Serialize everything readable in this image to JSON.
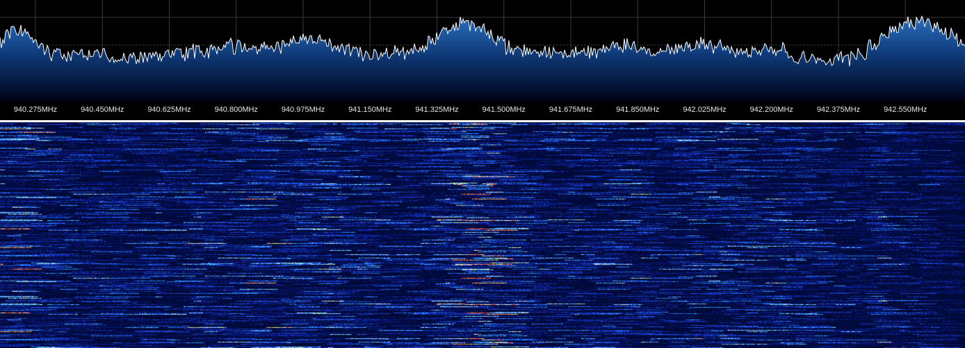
{
  "spectrum": {
    "frequency_labels": [
      "940.275MHz",
      "940.450MHz",
      "940.625MHz",
      "940.800MHz",
      "940.975MHz",
      "941.150MHz",
      "941.325MHz",
      "941.500MHz",
      "941.675MHz",
      "941.850MHz",
      "942.025MHz",
      "942.200MHz",
      "942.375MHz",
      "942.550MHz"
    ],
    "trace_color": "#ffffff",
    "fill_top_color": "#2a6fbf",
    "fill_bottom_color": "#000318",
    "grid_color": "#3a3a3a",
    "background_color": "#000000"
  },
  "waterfall": {
    "background_color": "#000a3a",
    "palette": [
      "#000a3a",
      "#0a1c8c",
      "#1e4fe0",
      "#39b7ff",
      "#ffffff",
      "#ffe23a",
      "#ff3a1a"
    ]
  }
}
